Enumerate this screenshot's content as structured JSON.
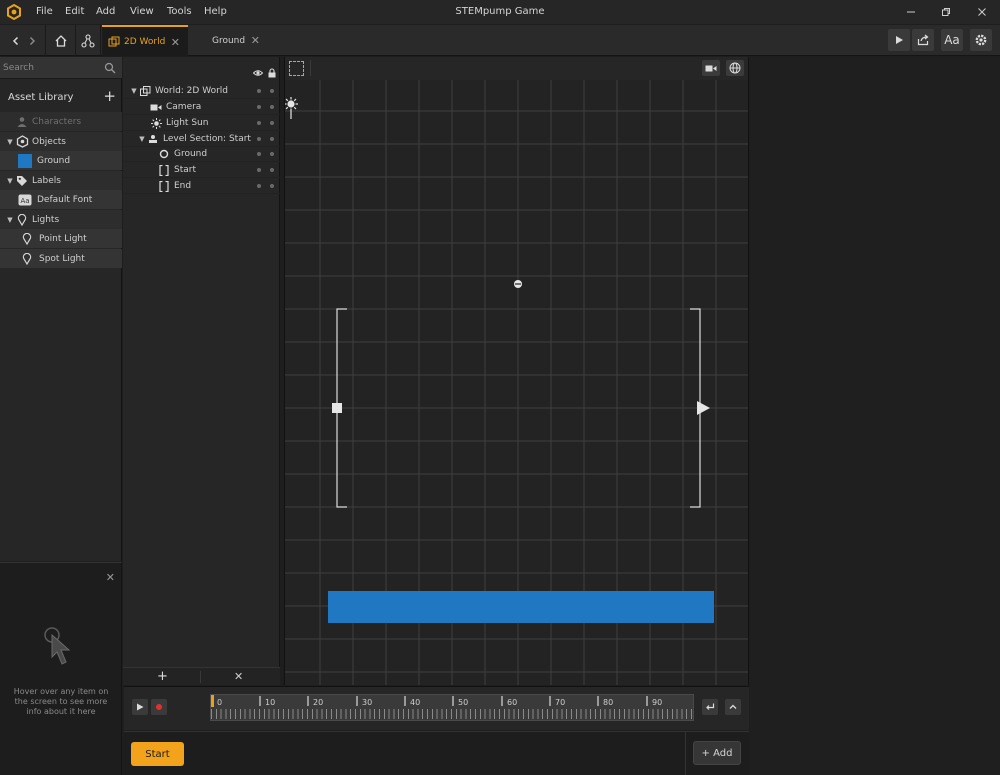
{
  "app": {
    "title": "STEMpump Game",
    "menu": [
      "File",
      "Edit",
      "Add",
      "View",
      "Tools",
      "Help"
    ]
  },
  "tabs": [
    {
      "label": "2D World",
      "active": true
    },
    {
      "label": "Ground",
      "active": false
    }
  ],
  "asset_library": {
    "search_placeholder": "Search",
    "title": "Asset Library",
    "add_label": "+",
    "rows": [
      {
        "label": "Characters",
        "kind": "category",
        "icon": "person-icon",
        "dim": true
      },
      {
        "label": "Objects",
        "kind": "category",
        "icon": "objects-icon"
      },
      {
        "label": "Ground",
        "kind": "item",
        "icon": "blue-swatch-icon"
      },
      {
        "label": "Labels",
        "kind": "category",
        "icon": "tag-icon"
      },
      {
        "label": "Default Font",
        "kind": "item",
        "icon": "font-icon"
      },
      {
        "label": "Lights",
        "kind": "category",
        "icon": "light-pin-icon"
      },
      {
        "label": "Point Light",
        "kind": "item",
        "icon": "light-pin-icon"
      },
      {
        "label": "Spot Light",
        "kind": "item",
        "icon": "light-pin-icon"
      }
    ]
  },
  "help": {
    "text": "Hover over any item on the screen to see more info about it here"
  },
  "hierarchy": {
    "rows": [
      {
        "label": "World: 2D World",
        "icon": "world-icon",
        "depth": 0,
        "caret": true
      },
      {
        "label": "Camera",
        "icon": "camera-icon",
        "depth": 1,
        "caret": false
      },
      {
        "label": "Light Sun",
        "icon": "sun-icon",
        "depth": 1,
        "caret": false
      },
      {
        "label": "Level Section: Start",
        "icon": "person-icon",
        "depth": 1,
        "caret": true
      },
      {
        "label": "Ground",
        "icon": "circle-icon",
        "depth": 2,
        "caret": false
      },
      {
        "label": "Start",
        "icon": "bracket-icon",
        "depth": 2,
        "caret": false
      },
      {
        "label": "End",
        "icon": "bracket-icon",
        "depth": 2,
        "caret": false
      }
    ]
  },
  "timeline": {
    "labels": [
      "0",
      "10",
      "20",
      "30",
      "40",
      "50",
      "60",
      "70",
      "80",
      "90"
    ]
  },
  "bottom": {
    "start_label": "Start",
    "add_label": "+ Add"
  },
  "colors": {
    "accent": "#f2a31b",
    "ground": "#1f78c1",
    "record": "#e03030"
  }
}
